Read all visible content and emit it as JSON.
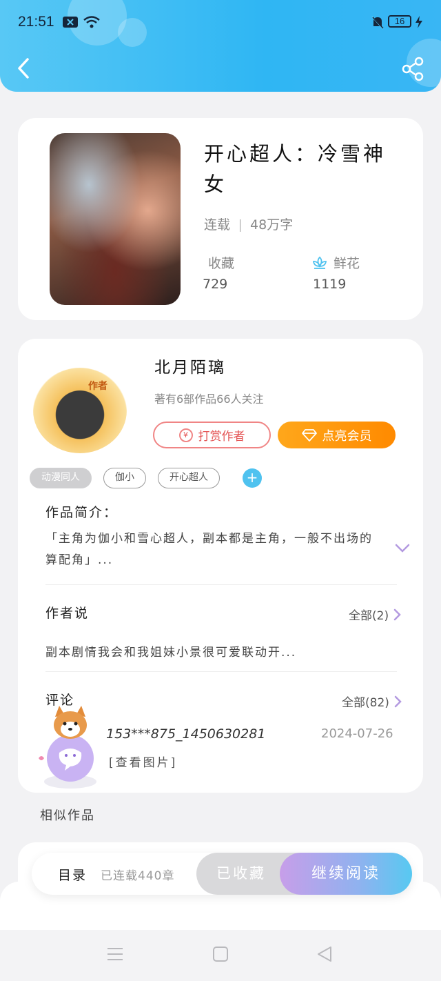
{
  "status_bar": {
    "time": "21:51",
    "battery": "16"
  },
  "book": {
    "title": "开心超人：冷雪神女",
    "status": "连载",
    "word_count": "48万字",
    "favorites_label": "收藏",
    "favorites_value": "729",
    "flowers_label": "鲜花",
    "flowers_value": "1119"
  },
  "author": {
    "name": "北月陌璃",
    "summary": "著有6部作品66人关注",
    "avatar_badge": "作者",
    "tip_button": "打赏作者",
    "vip_button": "点亮会员"
  },
  "tags": [
    "动漫同人",
    "伽小",
    "开心超人"
  ],
  "intro": {
    "title": "作品简介：",
    "text": "「主角为伽小和雪心超人，副本都是主角，一般不出场的算配角」..."
  },
  "author_says": {
    "title": "作者说",
    "all_label": "全部(2)",
    "text": "副本剧情我会和我姐妹小景很可爱联动开..."
  },
  "comments": {
    "title": "评论",
    "all_label": "全部(82)",
    "user": "153***875_1450630281",
    "date": "2024-07-26",
    "body": "[查看图片]"
  },
  "similar_title": "相似作品",
  "bottom_bar": {
    "toc_label": "目录",
    "toc_count": "已连载440章",
    "collected_label": "已收藏",
    "continue_label": "继续阅读"
  },
  "colors": {
    "header": "#2fb6f3",
    "vip": "#ff8a00",
    "tip": "#e45555",
    "accent": "#4fc2ef"
  }
}
